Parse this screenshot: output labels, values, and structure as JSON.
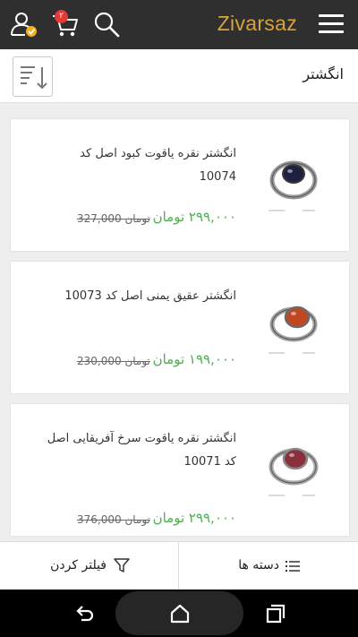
{
  "app": {
    "brand": "Zivarsaz",
    "cart_count": "۲"
  },
  "icons": {
    "menu": "hamburger-menu-icon",
    "account": "user-account-icon",
    "cart": "shopping-cart-icon",
    "search": "search-icon",
    "sort": "sort-icon",
    "filter": "filter-funnel-icon",
    "categories": "category-list-icon"
  },
  "colors": {
    "topbar": "#2f2f2f",
    "brand": "#d7a33a",
    "price": "#4caf50",
    "badge": "#e53935",
    "check_badge": "#f2b11b"
  },
  "page": {
    "title": "انگشتر"
  },
  "products": [
    {
      "name": "انگشتر نقره یاقوت کبود اصل کد 10074",
      "price": "۲۹۹,۰۰۰ تومان",
      "old_price": "327,000 تومان",
      "stone_color": "#1c2140"
    },
    {
      "name": "انگشتر عقیق یمنی اصل کد 10073",
      "price": "۱۹۹,۰۰۰ تومان",
      "old_price": "230,000 تومان",
      "stone_color": "#c0471f"
    },
    {
      "name": "انگشتر نقره یاقوت سرخ آفریقایی اصل کد 10071",
      "price": "۲۹۹,۰۰۰ تومان",
      "old_price": "376,000 تومان",
      "stone_color": "#8a2f3c"
    }
  ],
  "bottom_bar": {
    "filter_label": "فیلتر کردن",
    "categories_label": "دسته ها"
  }
}
